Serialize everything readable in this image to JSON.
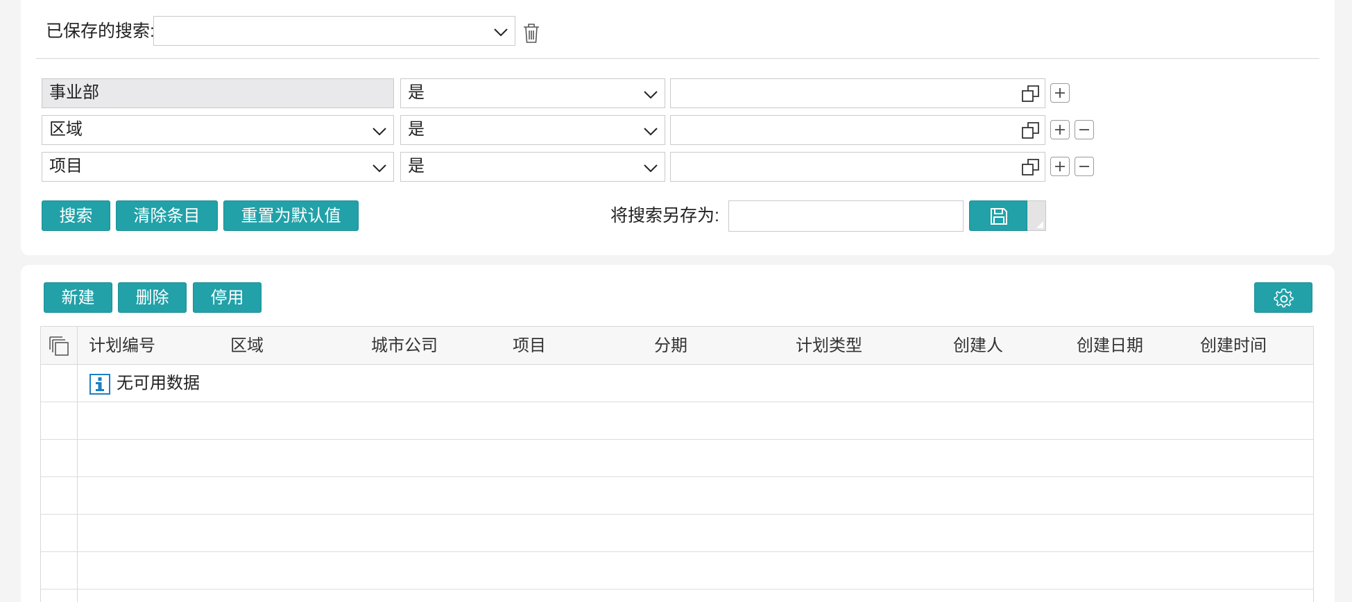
{
  "saved_search": {
    "label": "已保存的搜索:",
    "value": ""
  },
  "filters": [
    {
      "field": "事业部",
      "field_editable": false,
      "operator": "是",
      "value": ""
    },
    {
      "field": "区域",
      "field_editable": true,
      "operator": "是",
      "value": ""
    },
    {
      "field": "项目",
      "field_editable": true,
      "operator": "是",
      "value": ""
    }
  ],
  "search_actions": {
    "search": "搜索",
    "clear": "清除条目",
    "reset": "重置为默认值",
    "save_as_label": "将搜索另存为:",
    "save_as_value": ""
  },
  "toolbar": {
    "new": "新建",
    "delete": "删除",
    "disable": "停用"
  },
  "table": {
    "columns": [
      "计划编号",
      "区域",
      "城市公司",
      "项目",
      "分期",
      "计划类型",
      "创建人",
      "创建日期",
      "创建时间"
    ],
    "empty_message": "无可用数据"
  },
  "colors": {
    "accent": "#22a1a8",
    "info_icon": "#1a7fc1"
  },
  "icons": {
    "trash": "trash-icon",
    "chevron": "chevron-down-icon",
    "value_help": "value-help-icon",
    "add": "plus-icon",
    "remove": "minus-icon",
    "save": "floppy-disk-icon",
    "settings": "gear-icon",
    "select_all": "select-all-icon",
    "info": "info-icon"
  }
}
